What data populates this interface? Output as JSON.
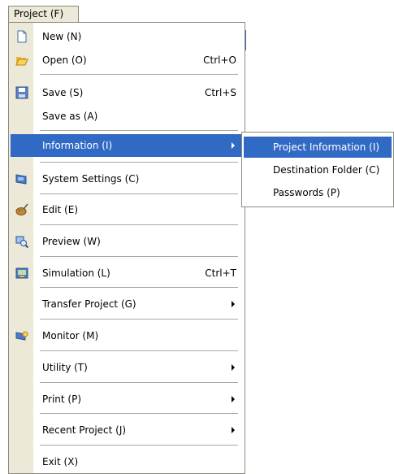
{
  "menubar": {
    "title": "Project (F)"
  },
  "menu": {
    "items": [
      {
        "label": "New (N)",
        "shortcut": "",
        "icon": "new-document-icon"
      },
      {
        "label": "Open (O)",
        "shortcut": "Ctrl+O",
        "icon": "folder-open-icon"
      },
      {
        "label": "Save (S)",
        "shortcut": "Ctrl+S",
        "icon": "save-icon"
      },
      {
        "label": "Save as (A)",
        "shortcut": ""
      },
      {
        "label": "Information (I)",
        "submenu": true
      },
      {
        "label": "System Settings (C)",
        "icon": "system-settings-icon"
      },
      {
        "label": "Edit (E)",
        "icon": "edit-palette-icon"
      },
      {
        "label": "Preview (W)",
        "icon": "preview-icon"
      },
      {
        "label": "Simulation  (L)",
        "shortcut": "Ctrl+T",
        "icon": "simulation-icon"
      },
      {
        "label": "Transfer Project (G)",
        "submenu": true
      },
      {
        "label": "Monitor (M)",
        "icon": "monitor-icon"
      },
      {
        "label": "Utility (T)",
        "submenu": true
      },
      {
        "label": "Print (P)",
        "submenu": true
      },
      {
        "label": "Recent Project (J)",
        "submenu": true
      },
      {
        "label": "Exit (X)"
      }
    ]
  },
  "submenu": {
    "items": [
      {
        "label": "Project Information (I)"
      },
      {
        "label": "Destination Folder (C)"
      },
      {
        "label": "Passwords (P)"
      }
    ]
  },
  "colors": {
    "highlight": "#316ac5",
    "menu_bg": "#ffffff",
    "icon_column": "#ece9d8"
  }
}
